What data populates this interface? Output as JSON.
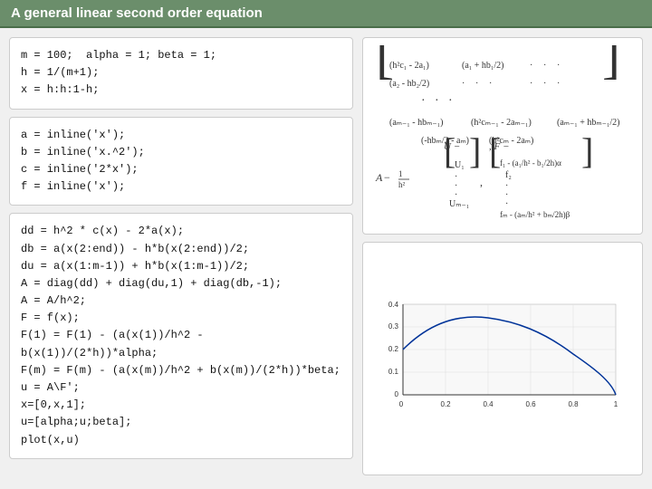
{
  "header": {
    "title": "A general linear second order equation"
  },
  "code": {
    "block1": "m = 100;  alpha = 1; beta = 1;\nh = 1/(m+1);\nx = h:h:1-h;",
    "block2": "a = inline('x');\nb = inline('x.^2');\nc = inline('2*x');\nf = inline('x');",
    "block3": "dd = h^2 * c(x) - 2*a(x);\ndb = a(x(2:end)) - h*b(x(2:end))/2;\ndu = a(x(1:m-1)) + h*b(x(1:m-1))/2;\nA = diag(dd) + diag(du,1) + diag(db,-1);\nA = A/h^2;\nF = f(x);\nF(1) = F(1) - (a(x(1))/h^2 - b(x(1))/(2*h))*alpha;\nF(m) = F(m) - (a(x(m))/h^2 + b(x(m))/(2*h))*beta;\nu = A\\F';\nx=[0,x,1];\nu=[alpha;u;beta];\nplot(x,u)"
  },
  "colors": {
    "header_bg": "#6b8e6b",
    "header_text": "#ffffff",
    "body_bg": "#f0f0f0",
    "panel_bg": "#ffffff",
    "border": "#cccccc"
  }
}
